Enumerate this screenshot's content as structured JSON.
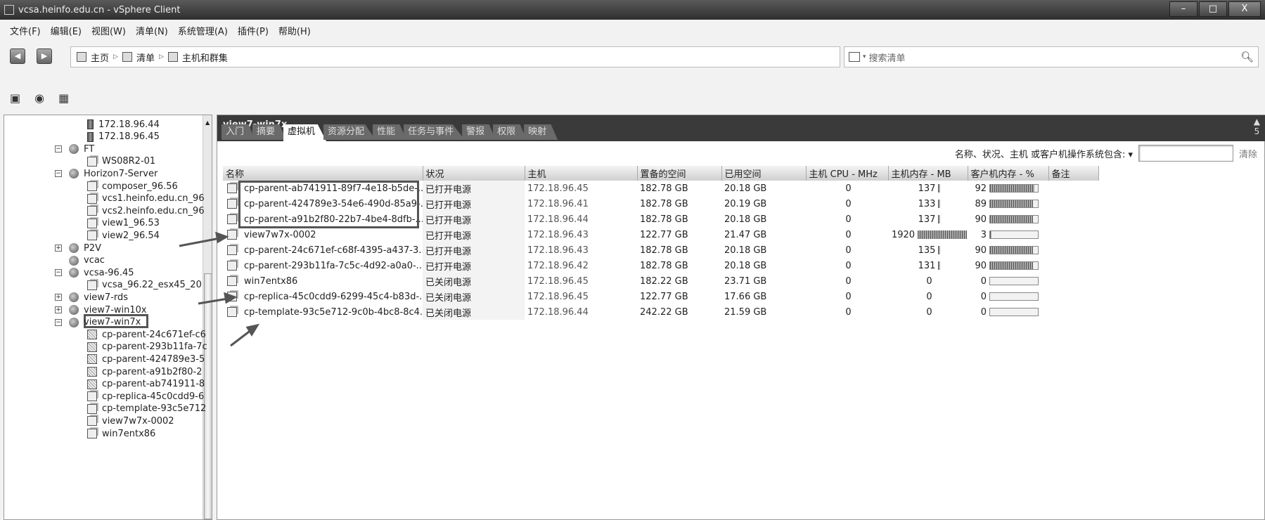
{
  "window": {
    "title": "vcsa.heinfo.edu.cn - vSphere Client",
    "minimize": "–",
    "maximize": "□",
    "close": "X"
  },
  "menu": [
    "文件(F)",
    "编辑(E)",
    "视图(W)",
    "清单(N)",
    "系统管理(A)",
    "插件(P)",
    "帮助(H)"
  ],
  "nav": {
    "back": "◀",
    "forward": "▶",
    "breadcrumb": [
      "主页",
      "清单",
      "主机和群集"
    ],
    "sep": "▷",
    "search_placeholder": "搜索清单",
    "search_icon": "magnifier-icon"
  },
  "toolbar": [
    "add-host-icon",
    "add-pool-icon",
    "add-cluster-icon"
  ],
  "tree": [
    {
      "label": "172.18.96.44",
      "icon": "host",
      "level": 2
    },
    {
      "label": "172.18.96.45",
      "icon": "host",
      "level": 2
    },
    {
      "label": "FT",
      "icon": "pool",
      "level": 1,
      "toggle": "−"
    },
    {
      "label": "WS08R2-01",
      "icon": "vm",
      "level": 2
    },
    {
      "label": "Horizon7-Server",
      "icon": "pool",
      "level": 1,
      "toggle": "−"
    },
    {
      "label": "composer_96.56",
      "icon": "vm",
      "level": 2
    },
    {
      "label": "vcs1.heinfo.edu.cn_96",
      "icon": "vm",
      "level": 2
    },
    {
      "label": "vcs2.heinfo.edu.cn_96",
      "icon": "vm",
      "level": 2
    },
    {
      "label": "view1_96.53",
      "icon": "vm",
      "level": 2
    },
    {
      "label": "view2_96.54",
      "icon": "vm",
      "level": 2
    },
    {
      "label": "P2V",
      "icon": "pool",
      "level": 1,
      "toggle": "+"
    },
    {
      "label": "vcac",
      "icon": "pool",
      "level": 1
    },
    {
      "label": "vcsa-96.45",
      "icon": "pool",
      "level": 1,
      "toggle": "−"
    },
    {
      "label": "vcsa_96.22_esx45_20",
      "icon": "vm",
      "level": 2
    },
    {
      "label": "view7-rds",
      "icon": "pool",
      "level": 1,
      "toggle": "+"
    },
    {
      "label": "view7-win10x",
      "icon": "pool",
      "level": 1,
      "toggle": "+"
    },
    {
      "label": "view7-win7x",
      "icon": "pool",
      "level": 1,
      "toggle": "−",
      "selected": true
    },
    {
      "label": "cp-parent-24c671ef-c6",
      "icon": "tpl",
      "level": 2
    },
    {
      "label": "cp-parent-293b11fa-7c",
      "icon": "tpl",
      "level": 2
    },
    {
      "label": "cp-parent-424789e3-5",
      "icon": "tpl",
      "level": 2
    },
    {
      "label": "cp-parent-a91b2f80-2",
      "icon": "tpl",
      "level": 2
    },
    {
      "label": "cp-parent-ab741911-8",
      "icon": "tpl",
      "level": 2
    },
    {
      "label": "cp-replica-45c0cdd9-6",
      "icon": "vm",
      "level": 2
    },
    {
      "label": "cp-template-93c5e712",
      "icon": "vm",
      "level": 2
    },
    {
      "label": "view7w7x-0002",
      "icon": "vm",
      "level": 2
    },
    {
      "label": "win7entx86",
      "icon": "vm",
      "level": 2
    }
  ],
  "main": {
    "title": "view7-win7x",
    "alert_count": "5",
    "tabs": [
      "入门",
      "摘要",
      "虚拟机",
      "资源分配",
      "性能",
      "任务与事件",
      "警报",
      "权限",
      "映射"
    ],
    "active_tab": "虚拟机",
    "filter_label": "名称、状况、主机 或客户机操作系统包含: ▾",
    "filter_value": "",
    "clear": "清除",
    "columns": [
      "名称",
      "状况",
      "主机",
      "置备的空间",
      "已用空间",
      "主机 CPU - MHz",
      "主机内存 - MB",
      "客户机内存 - %",
      "备注"
    ],
    "rows": [
      {
        "name": "cp-parent-ab741911-89f7-4e18-b5de-...",
        "status": "已打开电源",
        "host": "172.18.96.45",
        "prov": "182.78 GB",
        "used": "20.18 GB",
        "cpu": "0",
        "mem": "137",
        "mem_frac": 0.04,
        "guest": "92"
      },
      {
        "name": "cp-parent-424789e3-54e6-490d-85a9-...",
        "status": "已打开电源",
        "host": "172.18.96.41",
        "prov": "182.78 GB",
        "used": "20.19 GB",
        "cpu": "0",
        "mem": "133",
        "mem_frac": 0.04,
        "guest": "89"
      },
      {
        "name": "cp-parent-a91b2f80-22b7-4be4-8dfb-...",
        "status": "已打开电源",
        "host": "172.18.96.44",
        "prov": "182.78 GB",
        "used": "20.18 GB",
        "cpu": "0",
        "mem": "137",
        "mem_frac": 0.04,
        "guest": "90"
      },
      {
        "name": "view7w7x-0002",
        "status": "已打开电源",
        "host": "172.18.96.43",
        "prov": "122.77 GB",
        "used": "21.47 GB",
        "cpu": "0",
        "mem": "1920",
        "mem_frac": 1,
        "guest": "3"
      },
      {
        "name": "cp-parent-24c671ef-c68f-4395-a437-3...",
        "status": "已打开电源",
        "host": "172.18.96.43",
        "prov": "182.78 GB",
        "used": "20.18 GB",
        "cpu": "0",
        "mem": "135",
        "mem_frac": 0.04,
        "guest": "90"
      },
      {
        "name": "cp-parent-293b11fa-7c5c-4d92-a0a0-...",
        "status": "已打开电源",
        "host": "172.18.96.42",
        "prov": "182.78 GB",
        "used": "20.18 GB",
        "cpu": "0",
        "mem": "131",
        "mem_frac": 0.04,
        "guest": "90"
      },
      {
        "name": "win7entx86",
        "status": "已关闭电源",
        "host": "172.18.96.45",
        "prov": "182.22 GB",
        "used": "23.71 GB",
        "cpu": "0",
        "mem": "0",
        "mem_frac": 0,
        "guest": "0"
      },
      {
        "name": "cp-replica-45c0cdd9-6299-45c4-b83d-...",
        "status": "已关闭电源",
        "host": "172.18.96.45",
        "prov": "122.77 GB",
        "used": "17.66 GB",
        "cpu": "0",
        "mem": "0",
        "mem_frac": 0,
        "guest": "0"
      },
      {
        "name": "cp-template-93c5e712-9c0b-4bc8-8c4...",
        "status": "已关闭电源",
        "host": "172.18.96.44",
        "prov": "242.22 GB",
        "used": "21.59 GB",
        "cpu": "0",
        "mem": "0",
        "mem_frac": 0,
        "guest": "0"
      }
    ]
  }
}
